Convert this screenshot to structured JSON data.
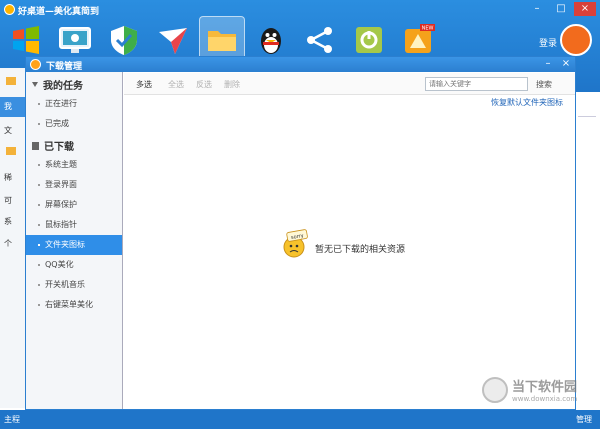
{
  "app": {
    "title": "好桌道—美化真简到",
    "toolbar_label_left": "系",
    "login": "登录",
    "bottom_left": "主程",
    "bottom_right": "管理",
    "side_peek": [
      "我",
      "文",
      "稀",
      "可",
      "系",
      "个"
    ],
    "tools": [
      {
        "icon": "windows-logo-icon"
      },
      {
        "icon": "monitor-icon"
      },
      {
        "icon": "shield-icon"
      },
      {
        "icon": "paper-plane-icon"
      },
      {
        "icon": "folder-icon"
      },
      {
        "icon": "qq-penguin-icon"
      },
      {
        "icon": "share-icon"
      },
      {
        "icon": "tools-icon"
      },
      {
        "icon": "fruit-new-icon",
        "badge": "NEW"
      }
    ]
  },
  "dialog": {
    "title": "下载管理",
    "sections": [
      {
        "label": "我的任务",
        "items": [
          "正在进行",
          "已完成"
        ]
      },
      {
        "label": "已下载",
        "items": [
          "系统主题",
          "登录界面",
          "屏幕保护",
          "鼠标指针",
          "文件夹图标",
          "QQ美化",
          "开关机音乐",
          "右键菜单美化"
        ]
      }
    ],
    "selected_item": "文件夹图标",
    "toolbar": {
      "multi_select": "多选",
      "select_all": "全选",
      "invert": "反选",
      "delete": "删除",
      "search_placeholder": "请输入关键字",
      "search_button": "搜索"
    },
    "restore_link": "恢复默认文件夹图标",
    "empty_badge": "sorry",
    "empty_message": "暂无已下载的相关资源"
  },
  "watermark": {
    "name": "当下软件园",
    "url": "www.downxia.com"
  },
  "colors": {
    "accent": "#2f8ee8",
    "titlebar": "#2b7fd0",
    "link": "#1f64b8"
  }
}
